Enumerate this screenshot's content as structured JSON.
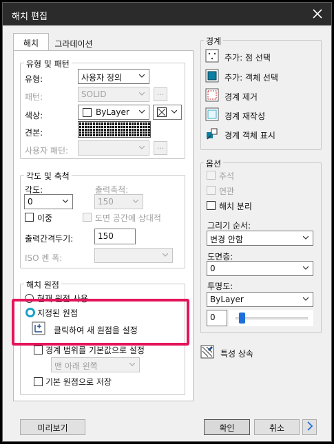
{
  "window": {
    "title": "해치 편집"
  },
  "tabs": [
    {
      "label": "해치",
      "active": true
    },
    {
      "label": "그라데이션",
      "active": false
    }
  ],
  "pattern_group": {
    "title": "유형 및 패턴",
    "type_label": "유형:",
    "type_value": "사용자 정의",
    "pattern_label": "패턴:",
    "pattern_value": "SOLID",
    "color_label": "색상:",
    "color_value": "ByLayer",
    "swatch_label": "견본:",
    "custom_pattern_label": "사용자 패턴:",
    "browse_label": "..."
  },
  "angle_group": {
    "title": "각도 및 축척",
    "angle_label": "각도:",
    "angle_value": "0",
    "scale_label": "출력축척:",
    "scale_value": "150",
    "double_label": "이중",
    "paper_space_label": "도면 공간에 상대적",
    "spacing_label": "출력간격두기:",
    "spacing_value": "150",
    "iso_label": "ISO 펜 폭:"
  },
  "origin_group": {
    "title": "해치 원점",
    "current_origin_label": "현재 원점 사용",
    "specified_origin_label": "지정된 원점",
    "click_set_label": "클릭하여 새 원점을 설정",
    "default_extents_label": "경계 범위를 기본값으로 설정",
    "position_value": "맨 아래 왼쪽",
    "store_default_label": "기본 원점으로 저장"
  },
  "boundaries": {
    "title": "경계",
    "add_pick_points": "추가: 점 선택",
    "add_select_objects": "추가: 객체 선택",
    "remove_boundaries": "경계 제거",
    "recreate_boundary": "경계 재작성",
    "display_boundary_objects": "경계 객체 표시"
  },
  "options": {
    "title": "옵션",
    "annotative_label": "주석",
    "associative_label": "연관",
    "separate_label": "해치 분리",
    "draw_order_label": "그리기 순서:",
    "draw_order_value": "변경 안함",
    "layer_label": "도면층:",
    "layer_value": "0",
    "transparency_label": "투명도:",
    "transparency_value": "ByLayer",
    "transparency_amount": "0",
    "transparency_fraction": 0.03
  },
  "inherit_label": "특성 상속",
  "footer": {
    "preview_label": "미리보기",
    "ok_label": "확인",
    "cancel_label": "취소"
  },
  "colors": {
    "highlight": "#e4145a",
    "accent": "#1e6fd9",
    "radio_selected": "#18a0c8"
  }
}
